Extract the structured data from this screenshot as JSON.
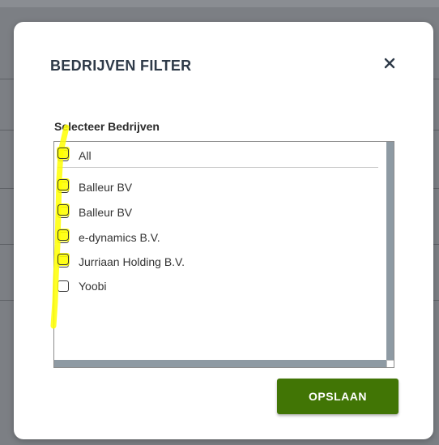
{
  "modal": {
    "title": "BEDRIJVEN FILTER",
    "close_icon": "close-icon",
    "section_label": "Selecteer Bedrijven",
    "all_label": "All",
    "companies": [
      "Balleur BV",
      "Balleur BV",
      "e-dynamics B.V.",
      "Jurriaan Holding B.V.",
      "Yoobi"
    ],
    "save_label": "OPSLAAN"
  },
  "colors": {
    "title": "#2e3a48",
    "save_button": "#417505",
    "highlight": "#ffff00"
  }
}
